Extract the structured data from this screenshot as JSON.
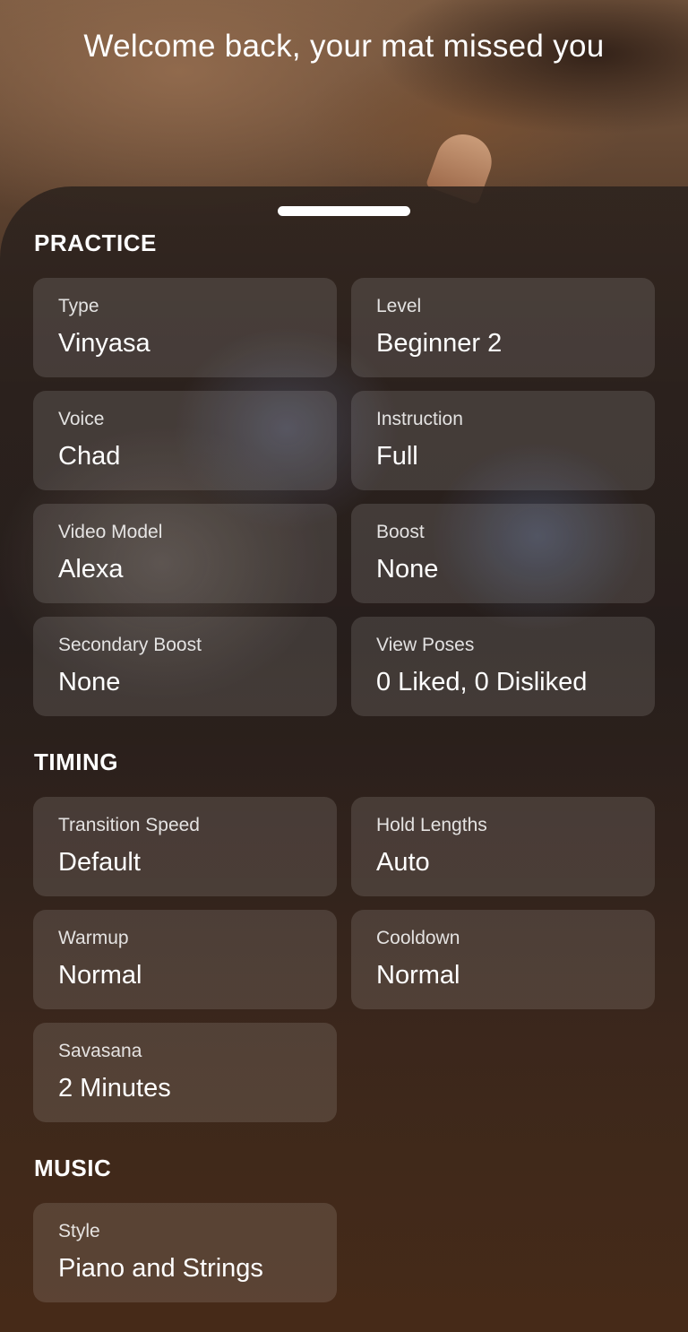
{
  "header": {
    "welcome": "Welcome back, your mat missed you"
  },
  "practice": {
    "title": "PRACTICE",
    "items": [
      {
        "label": "Type",
        "value": "Vinyasa"
      },
      {
        "label": "Level",
        "value": "Beginner 2"
      },
      {
        "label": "Voice",
        "value": "Chad"
      },
      {
        "label": "Instruction",
        "value": "Full"
      },
      {
        "label": "Video Model",
        "value": "Alexa"
      },
      {
        "label": "Boost",
        "value": "None"
      },
      {
        "label": "Secondary Boost",
        "value": "None"
      },
      {
        "label": "View Poses",
        "value": "0 Liked, 0 Disliked"
      }
    ]
  },
  "timing": {
    "title": "TIMING",
    "items": [
      {
        "label": "Transition Speed",
        "value": "Default"
      },
      {
        "label": "Hold Lengths",
        "value": "Auto"
      },
      {
        "label": "Warmup",
        "value": "Normal"
      },
      {
        "label": "Cooldown",
        "value": "Normal"
      },
      {
        "label": "Savasana",
        "value": "2 Minutes"
      }
    ]
  },
  "music": {
    "title": "MUSIC",
    "items": [
      {
        "label": "Style",
        "value": "Piano and Strings"
      }
    ]
  }
}
